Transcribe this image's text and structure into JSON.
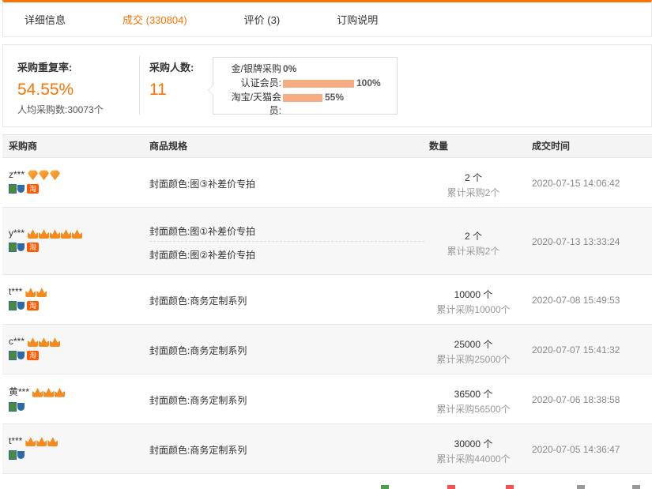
{
  "tabs": [
    {
      "label": "详细信息",
      "active": false
    },
    {
      "label": "成交 (330804)",
      "active": true
    },
    {
      "label": "评价 (3)",
      "active": false
    },
    {
      "label": "订购说明",
      "active": false
    }
  ],
  "summary": {
    "repeat_rate_label": "采购重复率:",
    "repeat_rate_value": "54.55%",
    "avg_label": "人均采购数:30073个",
    "buyers_label": "采购人数:",
    "buyers_value": "11",
    "breakdown": [
      {
        "label": "金/银牌采购",
        "pct": "0%",
        "fraction": 0.0
      },
      {
        "label": "认证会员:",
        "pct": "100%",
        "fraction": 1.0
      },
      {
        "label": "淘宝/天猫会员:",
        "pct": "55%",
        "fraction": 0.55
      }
    ]
  },
  "table": {
    "headers": {
      "buyer": "采购商",
      "spec": "商品规格",
      "qty": "数量",
      "time": "成交时间"
    },
    "rows": [
      {
        "buyer": "z***",
        "rank_type": "diamond",
        "rank_count": 3,
        "tao": true,
        "specs": [
          "封面颜色:图③补差价专拍"
        ],
        "qty": "2 个",
        "total": "累计采购2个",
        "time": "2020-07-15 14:06:42"
      },
      {
        "buyer": "y***",
        "rank_type": "crown",
        "rank_count": 5,
        "tao": true,
        "specs": [
          "封面颜色:图①补差价专拍",
          "封面颜色:图②补差价专拍"
        ],
        "qty": "2 个",
        "total": "累计采购2个",
        "time": "2020-07-13 13:33:24"
      },
      {
        "buyer": "t***",
        "rank_type": "crown",
        "rank_count": 2,
        "tao": true,
        "specs": [
          "封面颜色:商务定制系列"
        ],
        "qty": "10000 个",
        "total": "累计采购10000个",
        "time": "2020-07-08 15:49:53"
      },
      {
        "buyer": "c***",
        "rank_type": "crown",
        "rank_count": 3,
        "tao": true,
        "specs": [
          "封面颜色:商务定制系列"
        ],
        "qty": "25000 个",
        "total": "累计采购25000个",
        "time": "2020-07-07 15:41:32"
      },
      {
        "buyer": "黄***",
        "rank_type": "crown",
        "rank_count": 3,
        "tao": false,
        "specs": [
          "封面颜色:商务定制系列"
        ],
        "qty": "36500 个",
        "total": "累计采购56500个",
        "time": "2020-07-06 18:38:58"
      },
      {
        "buyer": "t***",
        "rank_type": "crown",
        "rank_count": 3,
        "tao": false,
        "specs": [
          "封面颜色:商务定制系列"
        ],
        "qty": "30000 个",
        "total": "累计采购44000个",
        "time": "2020-07-05 14:36:47"
      }
    ]
  },
  "colors": {
    "accent": "#ff7300",
    "bar": "#f5ad84"
  }
}
